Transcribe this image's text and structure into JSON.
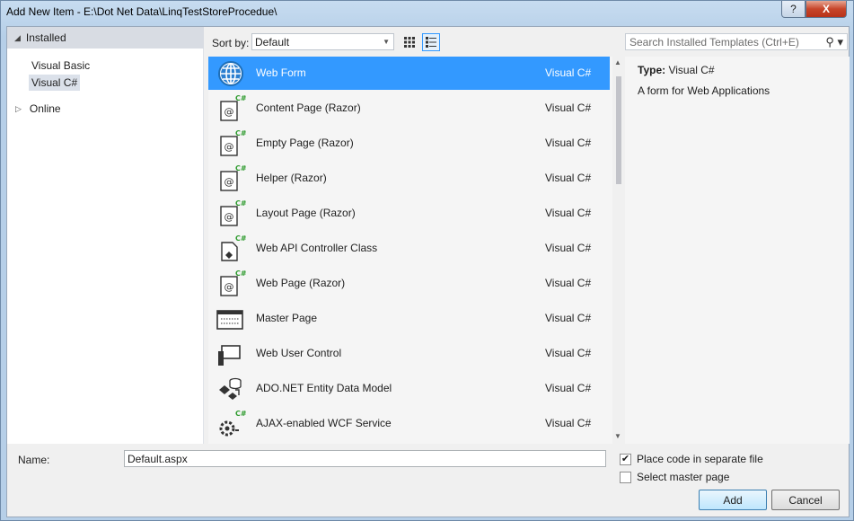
{
  "window": {
    "title": "Add New Item - E:\\Dot Net Data\\LinqTestStoreProcedue\\",
    "help_label": "?",
    "close_label": "X"
  },
  "tree": {
    "installed": "Installed",
    "children": [
      "Visual Basic",
      "Visual C#"
    ],
    "selected": "Visual C#",
    "online": "Online"
  },
  "toolbar": {
    "sort_label": "Sort by:",
    "sort_value": "Default",
    "search_placeholder": "Search Installed Templates (Ctrl+E)"
  },
  "templates": [
    {
      "name": "Web Form",
      "lang": "Visual C#",
      "icon": "globe-icon"
    },
    {
      "name": "Content Page (Razor)",
      "lang": "Visual C#",
      "icon": "razor-page-icon"
    },
    {
      "name": "Empty Page (Razor)",
      "lang": "Visual C#",
      "icon": "razor-page-icon"
    },
    {
      "name": "Helper (Razor)",
      "lang": "Visual C#",
      "icon": "razor-page-icon"
    },
    {
      "name": "Layout Page (Razor)",
      "lang": "Visual C#",
      "icon": "razor-page-icon"
    },
    {
      "name": "Web API Controller Class",
      "lang": "Visual C#",
      "icon": "controller-icon"
    },
    {
      "name": "Web Page (Razor)",
      "lang": "Visual C#",
      "icon": "razor-page-icon"
    },
    {
      "name": "Master Page",
      "lang": "Visual C#",
      "icon": "master-page-icon"
    },
    {
      "name": "Web User Control",
      "lang": "Visual C#",
      "icon": "user-control-icon"
    },
    {
      "name": "ADO.NET Entity Data Model",
      "lang": "Visual C#",
      "icon": "entity-model-icon"
    },
    {
      "name": "AJAX-enabled WCF Service",
      "lang": "Visual C#",
      "icon": "wcf-service-icon"
    }
  ],
  "selected_template": "Web Form",
  "detail": {
    "type_label": "Type:",
    "type_value": "Visual C#",
    "description": "A form for Web Applications"
  },
  "bottom": {
    "name_label": "Name:",
    "name_value": "Default.aspx",
    "place_code_label": "Place code in separate file",
    "place_code_checked": true,
    "master_page_label": "Select master page",
    "master_page_checked": false,
    "add_label": "Add",
    "cancel_label": "Cancel"
  },
  "colors": {
    "selection": "#3399ff",
    "csharp_badge": "#2e9b2e"
  }
}
